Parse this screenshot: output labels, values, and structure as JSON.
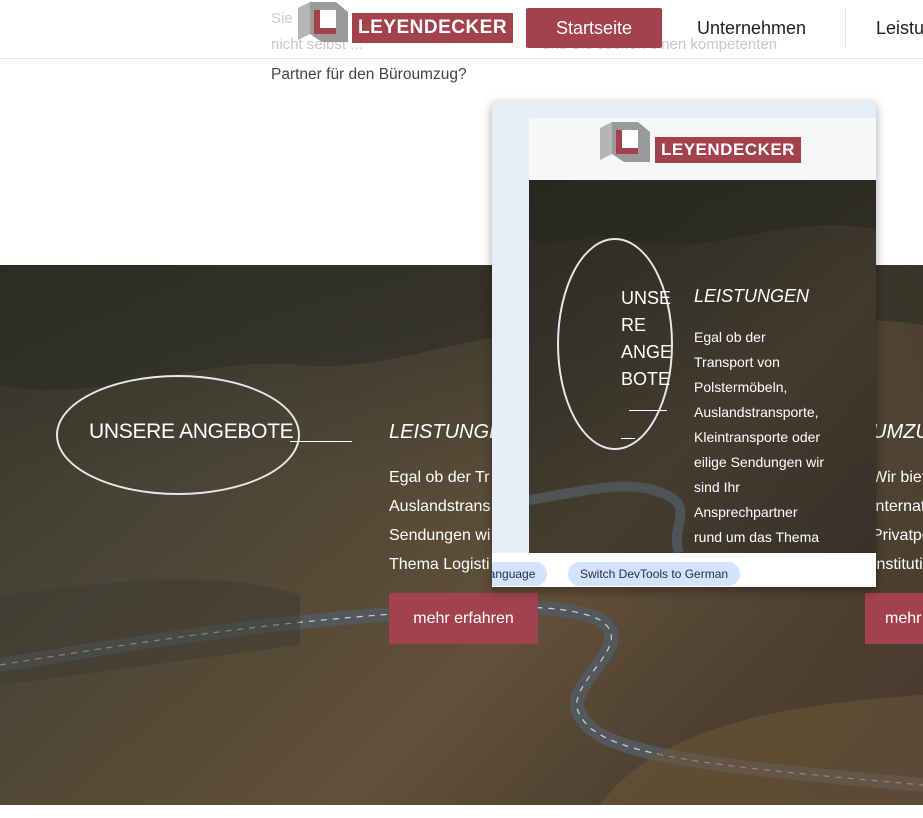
{
  "header": {
    "bg_line1": "Sie ... ",
    "bg_line2": "nicht selbst ... und Sie suchen einen kompetenten",
    "partner_text": "Partner für den Büroumzug?",
    "logo_text": "LEYENDECKER",
    "nav": {
      "startseite": "Startseite",
      "unternehmen": "Unternehmen",
      "leistungen": "Leistu"
    }
  },
  "hero": {
    "title": "UNSERE ANGEBOTE",
    "leistungen_heading": "LEISTUNGEN",
    "leistungen_text": "Egal ob der Tr\nAuslandstrans\nSendungen wi\nThema Logisti",
    "mehr_label": "mehr erfahren",
    "right_heading": "UMZU",
    "right_text": "Wir biet\ninternat\nPrivatpe\nInstituti",
    "mehr_right_label": "mehr"
  },
  "devtools": {
    "logo_text": "LEYENDECKER",
    "title": "UNSE\nRE\nANGE\nBOTE",
    "leistungen_heading": "LEISTUNGEN",
    "leistungen_text": "Egal ob der\nTransport von\nPolstermöbeln,\nAuslandstransporte,\nKleintransporte oder\neilige Sendungen wir\nsind Ihr\nAnsprechpartner\nrund um das Thema",
    "pill_language": "language",
    "pill_switch": "Switch DevTools to German"
  },
  "colors": {
    "brand_red": "#a3424d",
    "logo_grey": "#9a9a9a",
    "pill_bg": "#d3e3fd"
  }
}
